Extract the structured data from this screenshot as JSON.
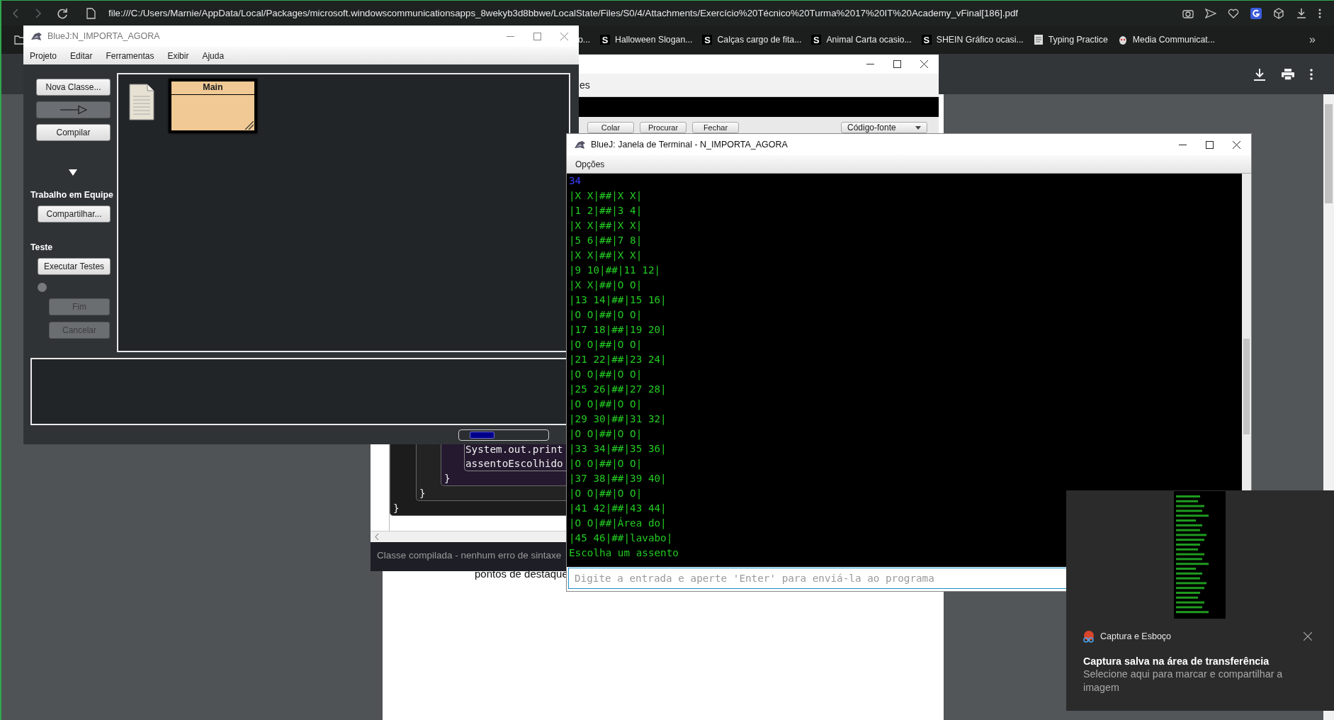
{
  "browser": {
    "url": "file:///C:/Users/Marnie/AppData/Local/Packages/microsoft.windowscommunicationsapps_8wekyb3d8bbwe/LocalState/Files/S0/4/Attachments/Exercício%20Técnico%20Turma%2017%20IT%20Academy_vFinal[186].pdf",
    "bookmarks": [
      {
        "kind": "text",
        "label": "o..."
      },
      {
        "kind": "letter",
        "badge": "S",
        "label": "Halloween Slogan..."
      },
      {
        "kind": "letter",
        "badge": "S",
        "label": "Calças cargo de fita..."
      },
      {
        "kind": "letter",
        "badge": "S",
        "label": "Animal Carta ocasio..."
      },
      {
        "kind": "letter",
        "badge": "S",
        "label": "SHEIN Gráfico ocasi..."
      },
      {
        "kind": "page",
        "label": "Typing Practice"
      },
      {
        "kind": "mascot",
        "label": "Media Communicat..."
      }
    ],
    "more": "»"
  },
  "bluej": {
    "title": "BlueJ:N_IMPORTA_AGORA",
    "menu": [
      "Projeto",
      "Editar",
      "Ferramentas",
      "Exibir",
      "Ajuda"
    ],
    "sidebar": [
      {
        "kind": "button",
        "label": "Nova Classe...",
        "disabled": false
      },
      {
        "kind": "arrow",
        "disabled": false
      },
      {
        "kind": "button",
        "label": "Compilar",
        "disabled": false
      },
      {
        "kind": "collapse"
      },
      {
        "kind": "heading",
        "label": "Trabalho em Equipe"
      },
      {
        "kind": "button",
        "label": "Compartilhar...",
        "disabled": false
      },
      {
        "kind": "heading",
        "label": "Teste"
      },
      {
        "kind": "button",
        "label": "Executar Testes",
        "disabled": false
      },
      {
        "kind": "record"
      },
      {
        "kind": "sub_button",
        "label": "Fim",
        "disabled": true
      },
      {
        "kind": "sub_button",
        "label": "Cancelar",
        "disabled": true
      }
    ],
    "diagram": [
      {
        "kind": "readme"
      },
      {
        "kind": "class",
        "name": "Main"
      }
    ]
  },
  "editor": {
    "menu_fragment": "es",
    "toolbar": [
      "Colar",
      "Procurar",
      "Fechar"
    ],
    "view_select": "Código-fonte",
    "code": {
      "closing": "}",
      "child": {
        "closing": "}",
        "child": {
          "closing": "}",
          "lines": [
            "System.out.print",
            "assentoEscolhido"
          ]
        }
      }
    },
    "status": "Classe compilada - nenhum erro de sintaxe"
  },
  "pdf": {
    "text": "pontos de destaque"
  },
  "terminal": {
    "title": "BlueJ: Janela de Terminal - N_IMPORTA_AGORA",
    "menu": [
      "Opções"
    ],
    "lines": [
      {
        "kind": "input",
        "text": "34"
      },
      {
        "kind": "output",
        "text": "|X X|##|X X|"
      },
      {
        "kind": "output",
        "text": "|1 2|##|3 4|"
      },
      {
        "kind": "output",
        "text": "|X X|##|X X|"
      },
      {
        "kind": "output",
        "text": "|5 6|##|7 8|"
      },
      {
        "kind": "output",
        "text": "|X X|##|X X|"
      },
      {
        "kind": "output",
        "text": "|9 10|##|11 12|"
      },
      {
        "kind": "output",
        "text": "|X X|##|O O|"
      },
      {
        "kind": "output",
        "text": "|13 14|##|15 16|"
      },
      {
        "kind": "output",
        "text": "|O O|##|O O|"
      },
      {
        "kind": "output",
        "text": "|17 18|##|19 20|"
      },
      {
        "kind": "output",
        "text": "|O O|##|O O|"
      },
      {
        "kind": "output",
        "text": "|21 22|##|23 24|"
      },
      {
        "kind": "output",
        "text": "|O O|##|O O|"
      },
      {
        "kind": "output",
        "text": "|25 26|##|27 28|"
      },
      {
        "kind": "output",
        "text": "|O O|##|O O|"
      },
      {
        "kind": "output",
        "text": "|29 30|##|31 32|"
      },
      {
        "kind": "output",
        "text": "|O O|##|O O|"
      },
      {
        "kind": "output",
        "text": "|33 34|##|35 36|"
      },
      {
        "kind": "output",
        "text": "|O O|##|O O|"
      },
      {
        "kind": "output",
        "text": "|37 38|##|39 40|"
      },
      {
        "kind": "output",
        "text": "|O O|##|O O|"
      },
      {
        "kind": "output",
        "text": "|41 42|##|43 44|"
      },
      {
        "kind": "output",
        "text": "|O O|##|Área do|"
      },
      {
        "kind": "output",
        "text": "|45 46|##|lavabo|"
      },
      {
        "kind": "output",
        "text": "Escolha um assento"
      }
    ],
    "placeholder": "Digite a entrada e aperte 'Enter' para enviá-la ao programa"
  },
  "notification": {
    "app": "Captura e Esboço",
    "title": "Captura salva na área de transferência",
    "body": "Selecione aqui para marcar e compartilhar a imagem"
  }
}
